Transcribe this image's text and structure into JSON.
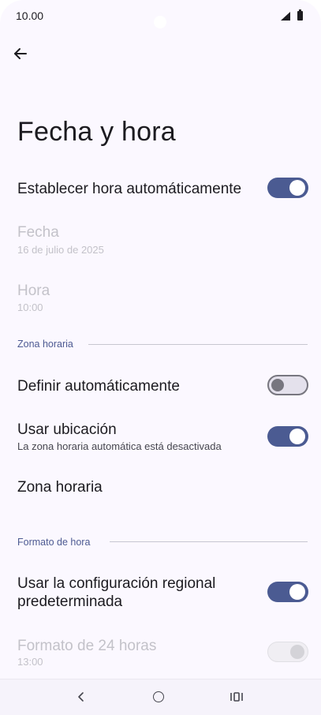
{
  "status": {
    "time": "10.00"
  },
  "header": {
    "title": "Fecha y hora"
  },
  "rows": {
    "auto_time": {
      "title": "Establecer hora automáticamente",
      "enabled": true
    },
    "date": {
      "title": "Fecha",
      "value": "16 de julio de 2025"
    },
    "time": {
      "title": "Hora",
      "value": "10:00"
    },
    "auto_zone": {
      "title": "Definir automáticamente",
      "enabled": false
    },
    "use_location": {
      "title": "Usar ubicación",
      "subtitle": "La zona horaria automática está desactivada",
      "enabled": true
    },
    "time_zone": {
      "title": "Zona horaria"
    },
    "regional_default": {
      "title_line1": "Usar la configuración regional",
      "title_line2": "predeterminada",
      "enabled": true
    },
    "format_24h": {
      "title": "Formato de 24 horas",
      "value": "13:00",
      "enabled": true
    }
  },
  "sections": {
    "time_zone": "Zona horaria",
    "time_format": "Formato de hora"
  },
  "colors": {
    "accent": "#4b5b92",
    "background": "#fbf8ff",
    "text": "#1c1b20",
    "disabled_text": "#c3c2c9"
  },
  "icons": {
    "back": "arrow-left-icon",
    "signal": "signal-icon",
    "battery": "battery-icon",
    "nav_back": "chevron-left-icon",
    "nav_home": "home-circle-icon",
    "nav_recents": "recents-icon"
  }
}
